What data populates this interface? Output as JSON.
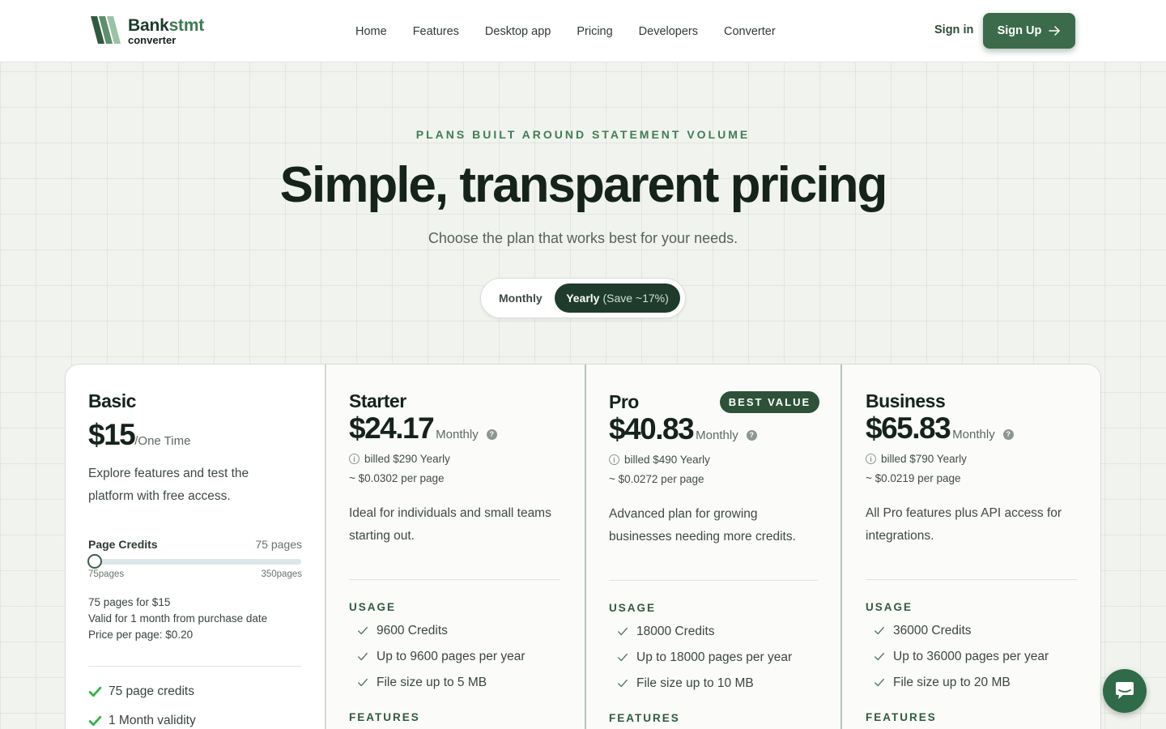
{
  "brand": {
    "name_part1": "Bank",
    "name_part2": "stmt",
    "sub": "converter"
  },
  "nav": {
    "links": [
      "Home",
      "Features",
      "Desktop app",
      "Pricing",
      "Developers",
      "Converter"
    ],
    "signin": "Sign in",
    "signup": "Sign Up"
  },
  "hero": {
    "eyebrow": "PLANS BUILT AROUND STATEMENT VOLUME",
    "title": "Simple, transparent pricing",
    "subtitle": "Choose the plan that works best for your needs."
  },
  "toggle": {
    "monthly": "Monthly",
    "yearly": "Yearly",
    "yearly_save": "(Save ~17%)",
    "selected": "Yearly"
  },
  "plans": [
    {
      "name": "Basic",
      "price": "$15",
      "unit": "/One Time",
      "description": "Explore features and test the platform with free access.",
      "credits_label": "Page Credits",
      "credits_value": "75 pages",
      "slider": {
        "min_label": "75pages",
        "max_label": "350pages",
        "min": 75,
        "max": 350,
        "value": 75
      },
      "summary": [
        "75 pages for $15",
        "Valid for 1 month from purchase date",
        "Price per page: $0.20"
      ],
      "features": [
        "75 page credits",
        "1 Month validity"
      ]
    },
    {
      "name": "Starter",
      "price": "$24.17",
      "unit": "Monthly",
      "billed": "billed $290 Yearly",
      "per_page": "~ $0.0302 per page",
      "description": "Ideal for individuals and small teams starting out.",
      "usage_label": "USAGE",
      "usage": [
        "9600 Credits",
        "Up to 9600 pages per year",
        "File size up to 5 MB"
      ],
      "features_label": "FEATURES"
    },
    {
      "name": "Pro",
      "badge": "BEST VALUE",
      "price": "$40.83",
      "unit": "Monthly",
      "billed": "billed $490 Yearly",
      "per_page": "~ $0.0272 per page",
      "description": "Advanced plan for growing businesses needing more credits.",
      "usage_label": "USAGE",
      "usage": [
        "18000 Credits",
        "Up to 18000 pages per year",
        "File size up to 10 MB"
      ],
      "features_label": "FEATURES"
    },
    {
      "name": "Business",
      "price": "$65.83",
      "unit": "Monthly",
      "billed": "billed $790 Yearly",
      "per_page": "~ $0.0219 per page",
      "description": "All Pro features plus API access for integrations.",
      "usage_label": "USAGE",
      "usage": [
        "36000 Credits",
        "Up to 36000 pages per year",
        "File size up to 20 MB"
      ],
      "features_label": "FEATURES"
    }
  ],
  "help_icon_glyph": "?",
  "info_icon_glyph": "i",
  "colors": {
    "accent": "#3b6b4b",
    "dark": "#1f3b2b",
    "eyebrow": "#3e7d55",
    "check_bright": "#2fb34a"
  }
}
